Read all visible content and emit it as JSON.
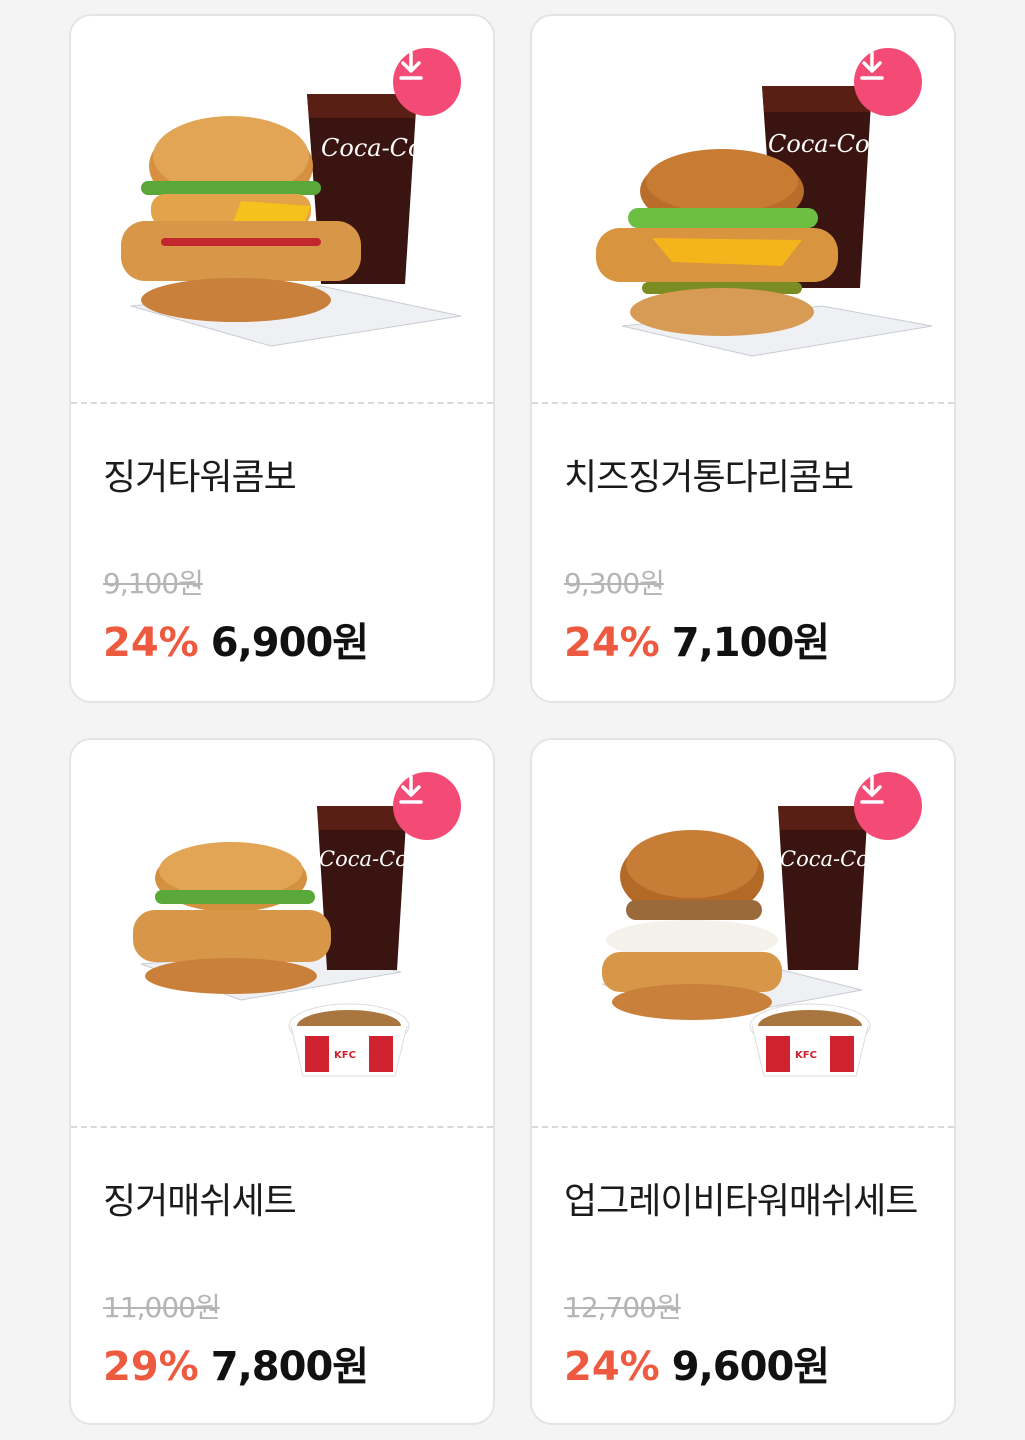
{
  "accent_color": "#f34b76",
  "discount_color": "#ee5a3f",
  "download_icon": "download-icon",
  "products": [
    {
      "name": "징거타워콤보",
      "original_price": "9,100원",
      "discount": "24%",
      "price": "6,900원"
    },
    {
      "name": "치즈징거통다리콤보",
      "original_price": "9,300원",
      "discount": "24%",
      "price": "7,100원"
    },
    {
      "name": "징거매쉬세트",
      "original_price": "11,000원",
      "discount": "29%",
      "price": "7,800원"
    },
    {
      "name": "업그레이비타워매쉬세트",
      "original_price": "12,700원",
      "discount": "24%",
      "price": "9,600원"
    }
  ]
}
